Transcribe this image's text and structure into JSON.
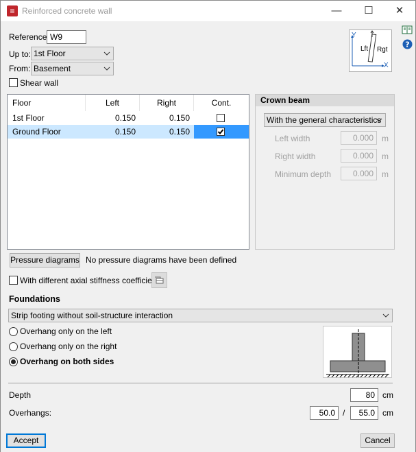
{
  "window": {
    "title": "Reinforced concrete wall",
    "minimize": "—",
    "maximize": "☐",
    "close": "✕"
  },
  "reference": {
    "label": "Reference",
    "value": "W9"
  },
  "up_to": {
    "label": "Up to:",
    "value": "1st Floor"
  },
  "from": {
    "label": "From:",
    "value": "Basement"
  },
  "shear_wall": {
    "label": "Shear wall",
    "checked": false
  },
  "floors_table": {
    "columns": [
      "Floor",
      "Left",
      "Right",
      "Cont."
    ],
    "rows": [
      {
        "floor": "1st Floor",
        "left": "0.150",
        "right": "0.150",
        "cont": false
      },
      {
        "floor": "Ground Floor",
        "left": "0.150",
        "right": "0.150",
        "cont": true
      }
    ]
  },
  "crown_beam": {
    "header": "Crown beam",
    "mode": "With the general characteristics",
    "fields": [
      {
        "label": "Left width",
        "value": "0.000",
        "unit": "m"
      },
      {
        "label": "Right width",
        "value": "0.000",
        "unit": "m"
      },
      {
        "label": "Minimum depth",
        "value": "0.000",
        "unit": "m"
      }
    ]
  },
  "diagram": {
    "y": "Y",
    "x": "X",
    "left": "Lft",
    "right": "Rgt"
  },
  "pressure": {
    "button": "Pressure diagrams",
    "status": "No pressure diagrams have been defined"
  },
  "axial": {
    "label": "With different axial stiffness coefficient",
    "checked": false
  },
  "foundations": {
    "header": "Foundations",
    "type": "Strip footing without soil-structure interaction",
    "options": [
      "Overhang only on the left",
      "Overhang only on the right",
      "Overhang on both sides"
    ],
    "selected": 2
  },
  "depth": {
    "label": "Depth",
    "value": "80",
    "unit": "cm"
  },
  "overhangs": {
    "label": "Overhangs:",
    "left": "50.0",
    "sep": "/",
    "right": "55.0",
    "unit": "cm"
  },
  "footer": {
    "accept": "Accept",
    "cancel": "Cancel"
  },
  "colors": {
    "selected_row": "#cce8ff",
    "selected_cell": "#3399ff",
    "icon_blue": "#1c5fb5"
  }
}
